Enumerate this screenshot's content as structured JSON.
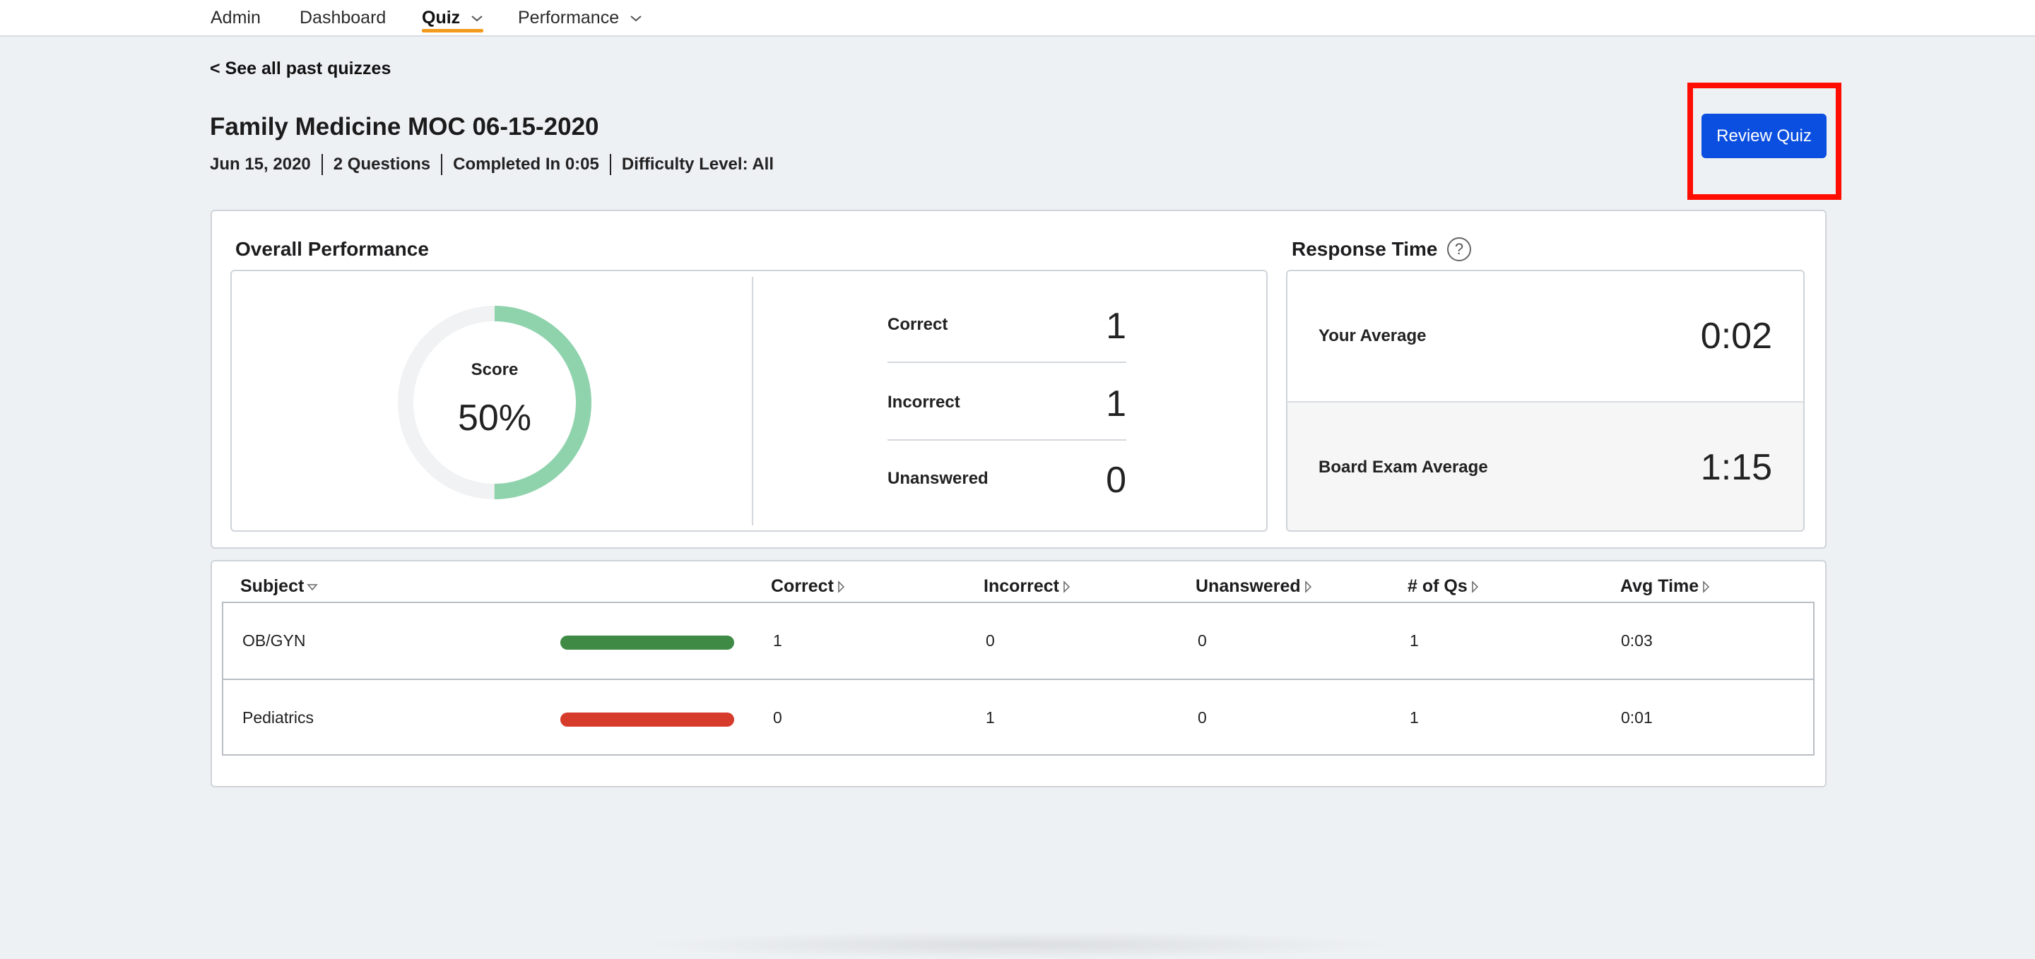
{
  "nav": {
    "items": [
      {
        "label": "Admin",
        "active": false,
        "has_dropdown": false
      },
      {
        "label": "Dashboard",
        "active": false,
        "has_dropdown": false
      },
      {
        "label": "Quiz",
        "active": true,
        "has_dropdown": true
      },
      {
        "label": "Performance",
        "active": false,
        "has_dropdown": true
      }
    ]
  },
  "header": {
    "back_link": "< See all past quizzes",
    "title": "Family Medicine MOC 06-15-2020",
    "meta": [
      "Jun 15, 2020",
      "2 Questions",
      "Completed In 0:05",
      "Difficulty Level: All"
    ],
    "review_button": "Review Quiz"
  },
  "overall": {
    "section_title": "Overall Performance",
    "score_label": "Score",
    "score_value": "50%",
    "score_fraction": 0.5,
    "stats": [
      {
        "label": "Correct",
        "value": "1"
      },
      {
        "label": "Incorrect",
        "value": "1"
      },
      {
        "label": "Unanswered",
        "value": "0"
      }
    ]
  },
  "response_time": {
    "section_title": "Response Time",
    "help_icon": "question-circle-icon",
    "rows": [
      {
        "label": "Your Average",
        "value": "0:02"
      },
      {
        "label": "Board Exam Average",
        "value": "1:15"
      }
    ]
  },
  "subjects": {
    "columns": [
      "Subject",
      "Correct",
      "Incorrect",
      "Unanswered",
      "# of Qs",
      "Avg Time"
    ],
    "rows": [
      {
        "subject": "OB/GYN",
        "correct": "1",
        "incorrect": "0",
        "unanswered": "0",
        "num_qs": "1",
        "avg_time": "0:03",
        "bar_color": "#3f8a45"
      },
      {
        "subject": "Pediatrics",
        "correct": "0",
        "incorrect": "1",
        "unanswered": "0",
        "num_qs": "1",
        "avg_time": "0:01",
        "bar_color": "#d63b2b"
      }
    ]
  },
  "colors": {
    "accent_blue": "#0b4fe0",
    "nav_active_underline": "#f39a1e",
    "score_ring": "#8fd3ad",
    "highlight_box": "#ff0d00"
  }
}
